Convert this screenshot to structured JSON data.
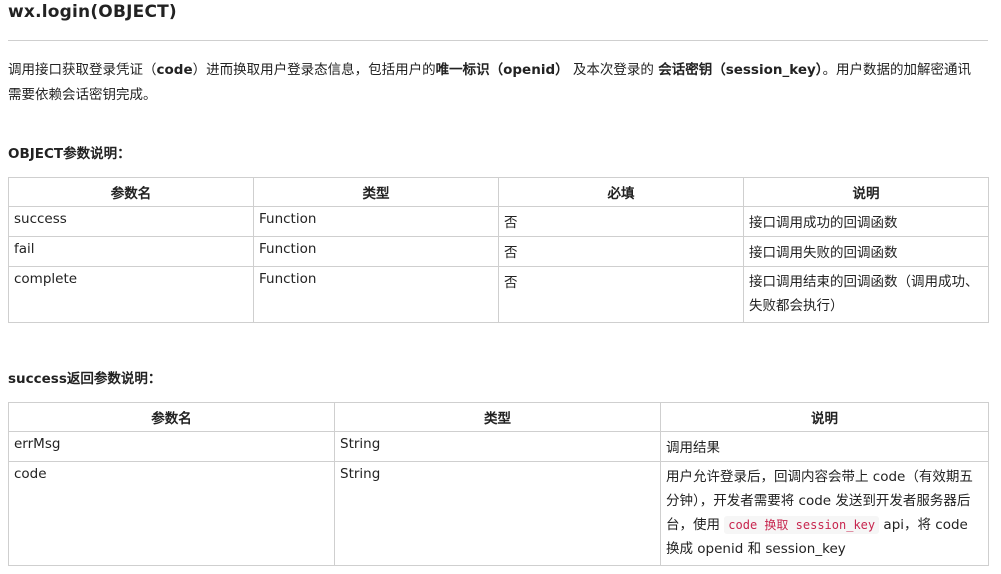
{
  "header": {
    "title": "wx.login(OBJECT)"
  },
  "intro": {
    "p1": "调用接口获取登录凭证（",
    "code_word": "code",
    "p2": "）进而换取用户登录态信息，包括用户的",
    "unique_id": "唯一标识（openid）",
    "p3": "及本次登录的",
    "session_key": "会话密钥（session_key）",
    "p4": "。用户数据的加解密通讯需要依赖会话密钥完成。"
  },
  "object_section": {
    "label_bold": "OBJECT",
    "label_rest": "参数说明：",
    "headers": [
      "参数名",
      "类型",
      "必填",
      "说明"
    ],
    "rows": [
      [
        "success",
        "Function",
        "否",
        "接口调用成功的回调函数"
      ],
      [
        "fail",
        "Function",
        "否",
        "接口调用失败的回调函数"
      ],
      [
        "complete",
        "Function",
        "否",
        "接口调用结束的回调函数（调用成功、失败都会执行）"
      ]
    ]
  },
  "success_section": {
    "label_bold": "success",
    "label_rest": "返回参数说明：",
    "headers": [
      "参数名",
      "类型",
      "说明"
    ],
    "rows": [
      [
        "errMsg",
        "String",
        "调用结果"
      ],
      [
        "code",
        "String",
        ""
      ]
    ],
    "code_desc": {
      "before": "用户允许登录后，回调内容会带上 code（有效期五分钟），开发者需要将 code 发送到开发者服务器后台，使用 ",
      "inline_code": "code 换取 session_key",
      "after": " api，将 code 换成 openid 和 session_key"
    }
  }
}
